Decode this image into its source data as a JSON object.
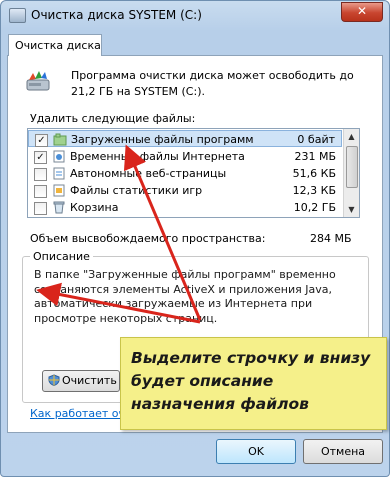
{
  "window": {
    "title": "Очистка диска SYSTEM (C:)",
    "close_glyph": "✕"
  },
  "tab": {
    "label": "Очистка диска"
  },
  "header_text": "Программа очистки диска может освободить до 21,2 ГБ на SYSTEM (C:).",
  "delete_label": "Удалить следующие файлы:",
  "files": [
    {
      "name": "Загруженные файлы программ",
      "size": "0 байт",
      "checked": true,
      "selected": true
    },
    {
      "name": "Временные файлы Интернета",
      "size": "231 МБ",
      "checked": true,
      "selected": false
    },
    {
      "name": "Автономные веб-страницы",
      "size": "51,6 КБ",
      "checked": false,
      "selected": false
    },
    {
      "name": "Файлы статистики игр",
      "size": "12,3 КБ",
      "checked": false,
      "selected": false
    },
    {
      "name": "Корзина",
      "size": "10,2 ГБ",
      "checked": false,
      "selected": false
    }
  ],
  "total": {
    "label": "Объем высвобождаемого пространства:",
    "value": "284 МБ"
  },
  "description": {
    "title": "Описание",
    "text": "В папке \"Загруженные файлы программ\" временно сохраняются элементы ActiveX и приложения Java, автоматически загружаемые из Интернета при просмотре некоторых страниц."
  },
  "clean_button": "Очистить с",
  "how_link": "Как работает очи",
  "ok_button": "OK",
  "cancel_button": "Отмена",
  "callout": {
    "text": "Выделите строчку и внизу будет описание назначения файлов"
  },
  "colors": {
    "accent_arrow": "#d9251c",
    "callout_bg": "#f5f08a",
    "link": "#0066cc"
  }
}
